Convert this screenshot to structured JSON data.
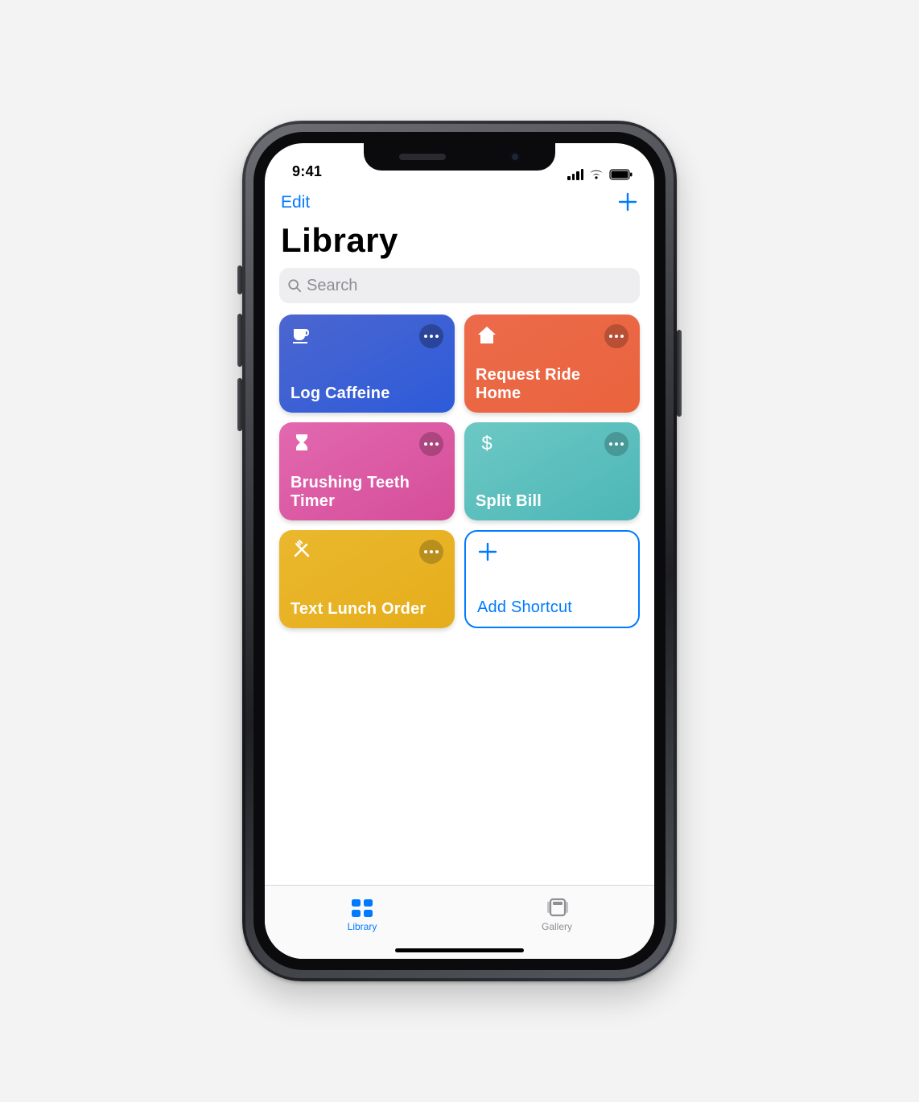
{
  "status": {
    "time": "9:41"
  },
  "nav": {
    "edit_label": "Edit"
  },
  "page": {
    "title": "Library"
  },
  "search": {
    "placeholder": "Search"
  },
  "shortcuts": [
    {
      "label": "Log Caffeine",
      "icon": "cup",
      "color": "#2d5bda"
    },
    {
      "label": "Request Ride Home",
      "icon": "home",
      "color": "#ea633d"
    },
    {
      "label": "Brushing Teeth Timer",
      "icon": "hourglass",
      "color": "#d54d99"
    },
    {
      "label": "Split Bill",
      "icon": "dollar",
      "color": "#4cb7b7"
    },
    {
      "label": "Text Lunch Order",
      "icon": "utensils",
      "color": "#e5ad1b"
    }
  ],
  "add_tile": {
    "label": "Add Shortcut"
  },
  "tabs": {
    "library": "Library",
    "gallery": "Gallery",
    "active": "library"
  },
  "colors": {
    "accent": "#007aff",
    "inactive": "#8e8e93",
    "search_bg": "#eeeef0"
  }
}
